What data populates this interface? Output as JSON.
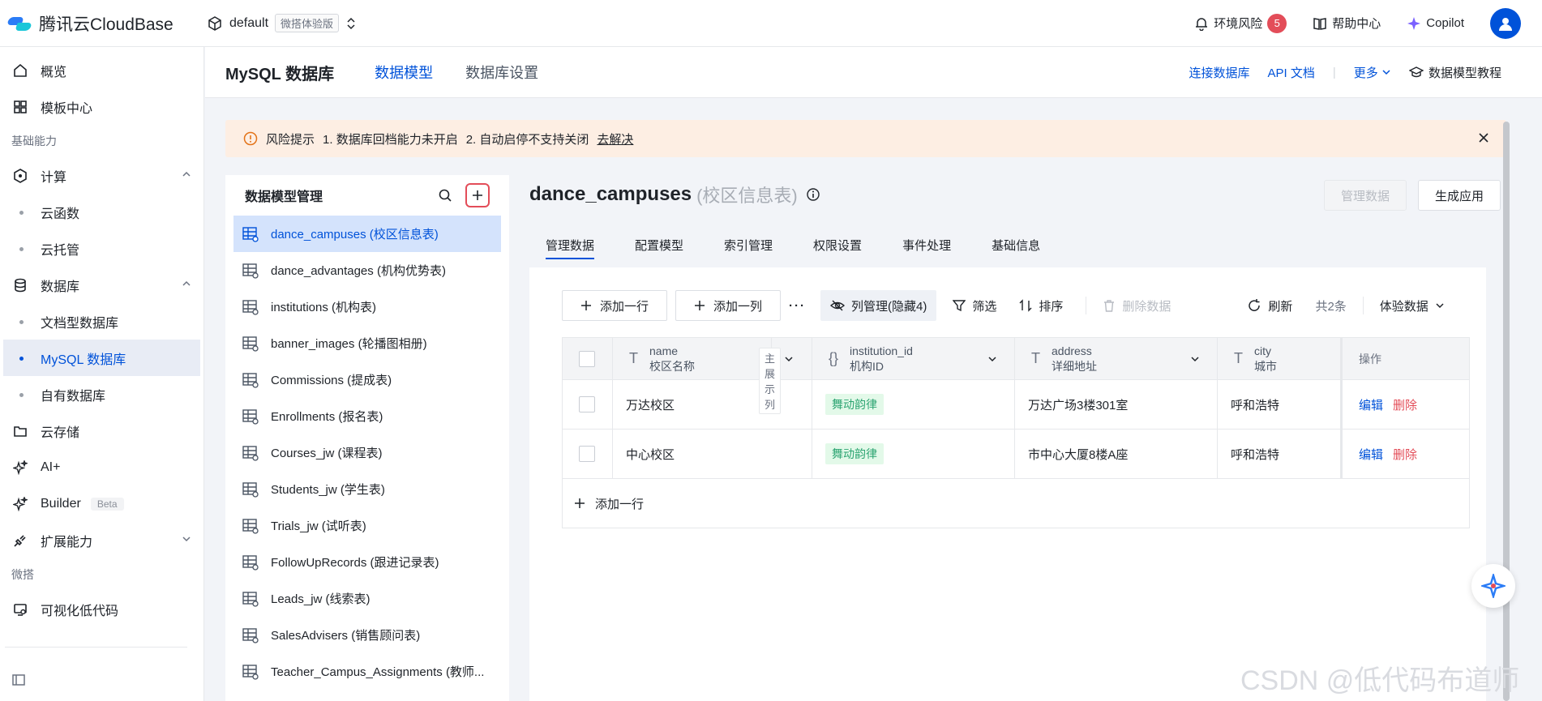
{
  "topbar": {
    "brand": "腾讯云CloudBase",
    "env_name": "default",
    "env_tag": "微搭体验版",
    "risk_label": "环境风险",
    "risk_count": "5",
    "help": "帮助中心",
    "copilot": "Copilot"
  },
  "sidebar": {
    "overview": "概览",
    "templates": "模板中心",
    "section_basic": "基础能力",
    "compute": "计算",
    "cloud_function": "云函数",
    "cloud_run": "云托管",
    "database": "数据库",
    "doc_db": "文档型数据库",
    "mysql_db": "MySQL 数据库",
    "own_db": "自有数据库",
    "storage": "云存储",
    "ai": "AI+",
    "builder": "Builder",
    "builder_badge": "Beta",
    "extensions": "扩展能力",
    "section_weda": "微搭",
    "lowcode": "可视化低代码"
  },
  "header": {
    "title": "MySQL 数据库",
    "tab_models": "数据模型",
    "tab_settings": "数据库设置",
    "connect": "连接数据库",
    "api_doc": "API 文档",
    "more": "更多",
    "tutorial": "数据模型教程"
  },
  "alert": {
    "label": "风险提示",
    "msg1": "1. 数据库回档能力未开启",
    "msg2": "2. 自动启停不支持关闭",
    "action": "去解决"
  },
  "models_panel": {
    "title": "数据模型管理",
    "items": [
      "dance_campuses (校区信息表)",
      "dance_advantages (机构优势表)",
      "institutions (机构表)",
      "banner_images (轮播图相册)",
      "Commissions (提成表)",
      "Enrollments (报名表)",
      "Courses_jw (课程表)",
      "Students_jw (学生表)",
      "Trials_jw (试听表)",
      "FollowUpRecords (跟进记录表)",
      "Leads_jw (线索表)",
      "SalesAdvisers (销售顾问表)",
      "Teacher_Campus_Assignments (教师..."
    ]
  },
  "main": {
    "model_name": "dance_campuses",
    "model_label": "(校区信息表)",
    "btn_manage": "管理数据",
    "btn_generate": "生成应用",
    "tabs": [
      "管理数据",
      "配置模型",
      "索引管理",
      "权限设置",
      "事件处理",
      "基础信息"
    ],
    "toolbar": {
      "add_row": "添加一行",
      "add_col": "添加一列",
      "col_manage": "列管理(隐藏4)",
      "filter": "筛选",
      "sort": "排序",
      "delete": "删除数据",
      "refresh": "刷新",
      "total": "共2条",
      "data_env": "体验数据"
    },
    "columns": [
      {
        "field": "name",
        "label": "校区名称",
        "extra": "主展示列"
      },
      {
        "field": "institution_id",
        "label": "机构ID"
      },
      {
        "field": "address",
        "label": "详细地址"
      },
      {
        "field": "city",
        "label": "城市"
      }
    ],
    "ops_header": "操作",
    "rows": [
      {
        "name": "万达校区",
        "institution": "舞动韵律",
        "address": "万达广场3楼301室",
        "city": "呼和浩特"
      },
      {
        "name": "中心校区",
        "institution": "舞动韵律",
        "address": "市中心大厦8楼A座",
        "city": "呼和浩特"
      }
    ],
    "edit": "编辑",
    "del": "删除",
    "add_row_bottom": "添加一行"
  },
  "watermark": "CSDN @低代码布道师"
}
